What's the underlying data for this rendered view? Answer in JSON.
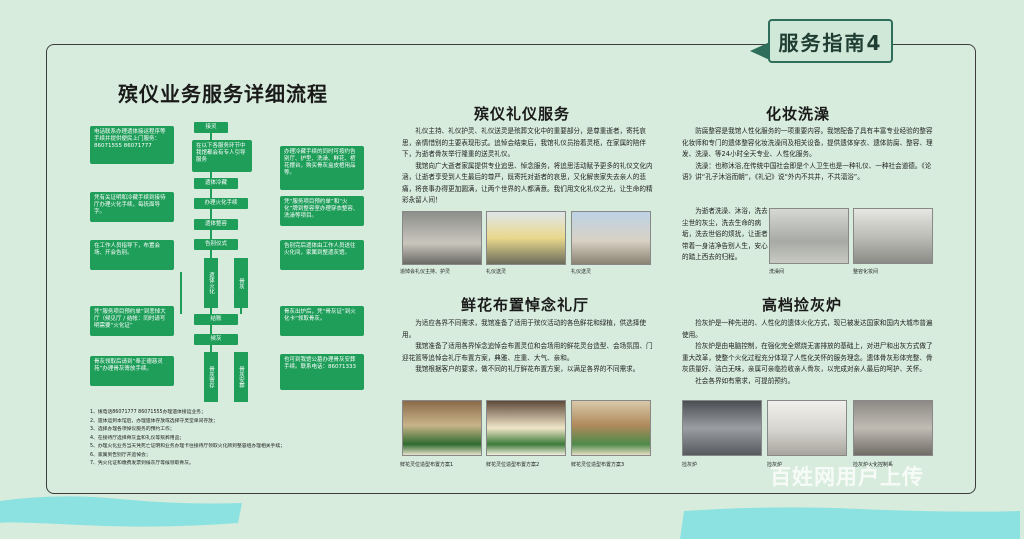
{
  "tab_label": "服务指南4",
  "main_title": "殡仪业务服务详细流程",
  "flowchart": {
    "left_boxes": [
      "电话联系办理遗体接运程序等手续并提供便民上门服务：86071555 86071777",
      "凭有关证明和冷藏手续到接待厅办理火化手续，每抚面导字。",
      "在工作人员指导下，布置会场、开会告别。",
      "凭“服务项目预约单”到悲悼大厅（候见厅 / 结帐：同时请写明需要“火化证”",
      "骨灰领取后请到“奉正德慈灵苑”办理骨灰寄放手续。"
    ],
    "right_boxes": [
      "办理冷藏手续的同时可按约告别厅、护型、洗澡、鲜花、棺花摆台，购买骨灰盒皮棺用品等。",
      "凭“服务项目预约单”和“火化”牌到整容室办理穿衣整容、洗澡等项目。",
      "告别完后遗体由工作人员送往火化间，家属到整遗灰馆。",
      "骨灰出炉后，凭“骨灰证”到火化卡“领取骨灰。",
      "也可到我馆公墓办理骨灰安葬手续。联系电话：86071333"
    ],
    "nodes": {
      "receive": "接灵",
      "inform": "在以下各服务环节中我馆都会有专人引导服务",
      "cold_storage": "遗体冷藏",
      "cremation_proc": "办理火化手续",
      "dressing": "遗体整容",
      "farewell": "告别仪式",
      "cremation": "遗体火化",
      "note": "骨灰",
      "settle": "结账",
      "collect": "候灰",
      "store": "骨灰寄存",
      "bury": "骨灰安葬"
    },
    "notes": [
      "1、拨电话86071777 86071555办理遗体接运业务；",
      "2、遗体运到本馆后，办理遗体存放或选择守灵堂单间存放；",
      "3、选择办理各项悼仪服务的预约工作；",
      "4、在接待厅选择骨灰盒和礼仪等殡葬用品；",
      "5、办理火化业务当天凭死亡证明和业务办理卡往接待厅领取火化牌到整容组办理相关手续；",
      "6、家属到告别厅开追悼会；",
      "7、凭火化证和缴费发票到候灰厅等候领取骨灰。"
    ]
  },
  "sections": {
    "etiquette": {
      "title": "殡仪礼仪服务",
      "paragraphs": [
        "礼仪主持、礼仪护灵、礼仪送灵是殡葬文化中的重要部分，是尊重逝者，寄托哀思，亲情惜别的主要表现形式。追悼会结束后，我馆礼仪员抬着灵柩，在家属的陪伴下，为逝者骨灰举行隆重的送灵礼仪。",
        "我馆向广大逝者家属提供专业追思、悼念服务，将追思活动赋予更多的礼仪文化内涵，让逝者享受到人生最后的尊严，既寄托对逝者的哀思，又化解丧家失去亲人的悲痛，将丧事办得更加圆满，让两个世界的人都满意。我们用文化礼仪之光，让生命的精彩永留人间！"
      ],
      "captions": [
        "追悼会礼仪主持、护灵",
        "礼仪送灵",
        "礼仪送灵"
      ]
    },
    "makeup": {
      "title": "化妆洗澡",
      "paragraphs": [
        "防腐整容是我馆人性化服务的一项重要内容。我馆配备了具有丰富专业经验的整容化妆师和专门的遗体整容化妆洗澡间及相关设备，提供遗体穿衣、遗体防腐、整容、理发、洗澡、等24小时全天专业、人性化服务。",
        "洗澡：也称沐浴,在传统中国社会即是个人卫生也是一种礼仪、一种社会道德。《论语》讲“孔子沐浴而朝”，《礼记》说“外内不共井，不共湢浴”。",
        "为逝者洗澡、沐浴，洗去尘世的灰尘，洗去生命的病垢，洗去世俗的烦扰，让逝者带着一身洁净告别人生，安心的踏上西去的归程。"
      ],
      "captions": [
        "洗澡间",
        "整容化妆间"
      ]
    },
    "flowers": {
      "title": "鲜花布置悼念礼厅",
      "paragraphs": [
        "为适应各界不同需求，我馆准备了适用于殡仪活动的各色鲜花和绿植，供选择使用。",
        "我馆准备了适用各界悼念追悼会布置灵位和会场用的鲜花灵台造型、会场氛围、门迎花篮等追悼会礼厅布置方案，典雅、庄重、大气、亲和。",
        "我馆根据客户的要求，做不同的礼厅鲜花布置方案，以满足各界的不同需求。"
      ],
      "captions": [
        "鲜花灵位造型布置方案1",
        "鲜花灵位造型布置方案2",
        "鲜花灵位造型布置方案3"
      ]
    },
    "ash": {
      "title": "高档捡灰炉",
      "paragraphs": [
        "捡灰炉是一种先进的、人性化的遗体火化方式，现已被发达国家和国内大城市普遍使用。",
        "捡灰炉是由电脑控制，在强化完全燃烧无害排放的基础上，对进尸和出灰方式做了重大改革，使整个火化过程充分体现了人性化关怀的服务理念。遗体骨灰形体完整、骨灰质量好、洁白无味，亲属可亲临捡收亲人骨灰，以完成对亲人最后的呵护、关怀。",
        "社会各界如有需求，可提前预约。"
      ],
      "captions": [
        "捡灰炉",
        "捡灰炉",
        "捡灰炉火化控制系"
      ]
    }
  },
  "watermark": "百姓网用户上传",
  "colors": {
    "flow_green": "#1f9e5a",
    "background": "#d7ecdd",
    "tab_border": "#2f6e5a"
  }
}
